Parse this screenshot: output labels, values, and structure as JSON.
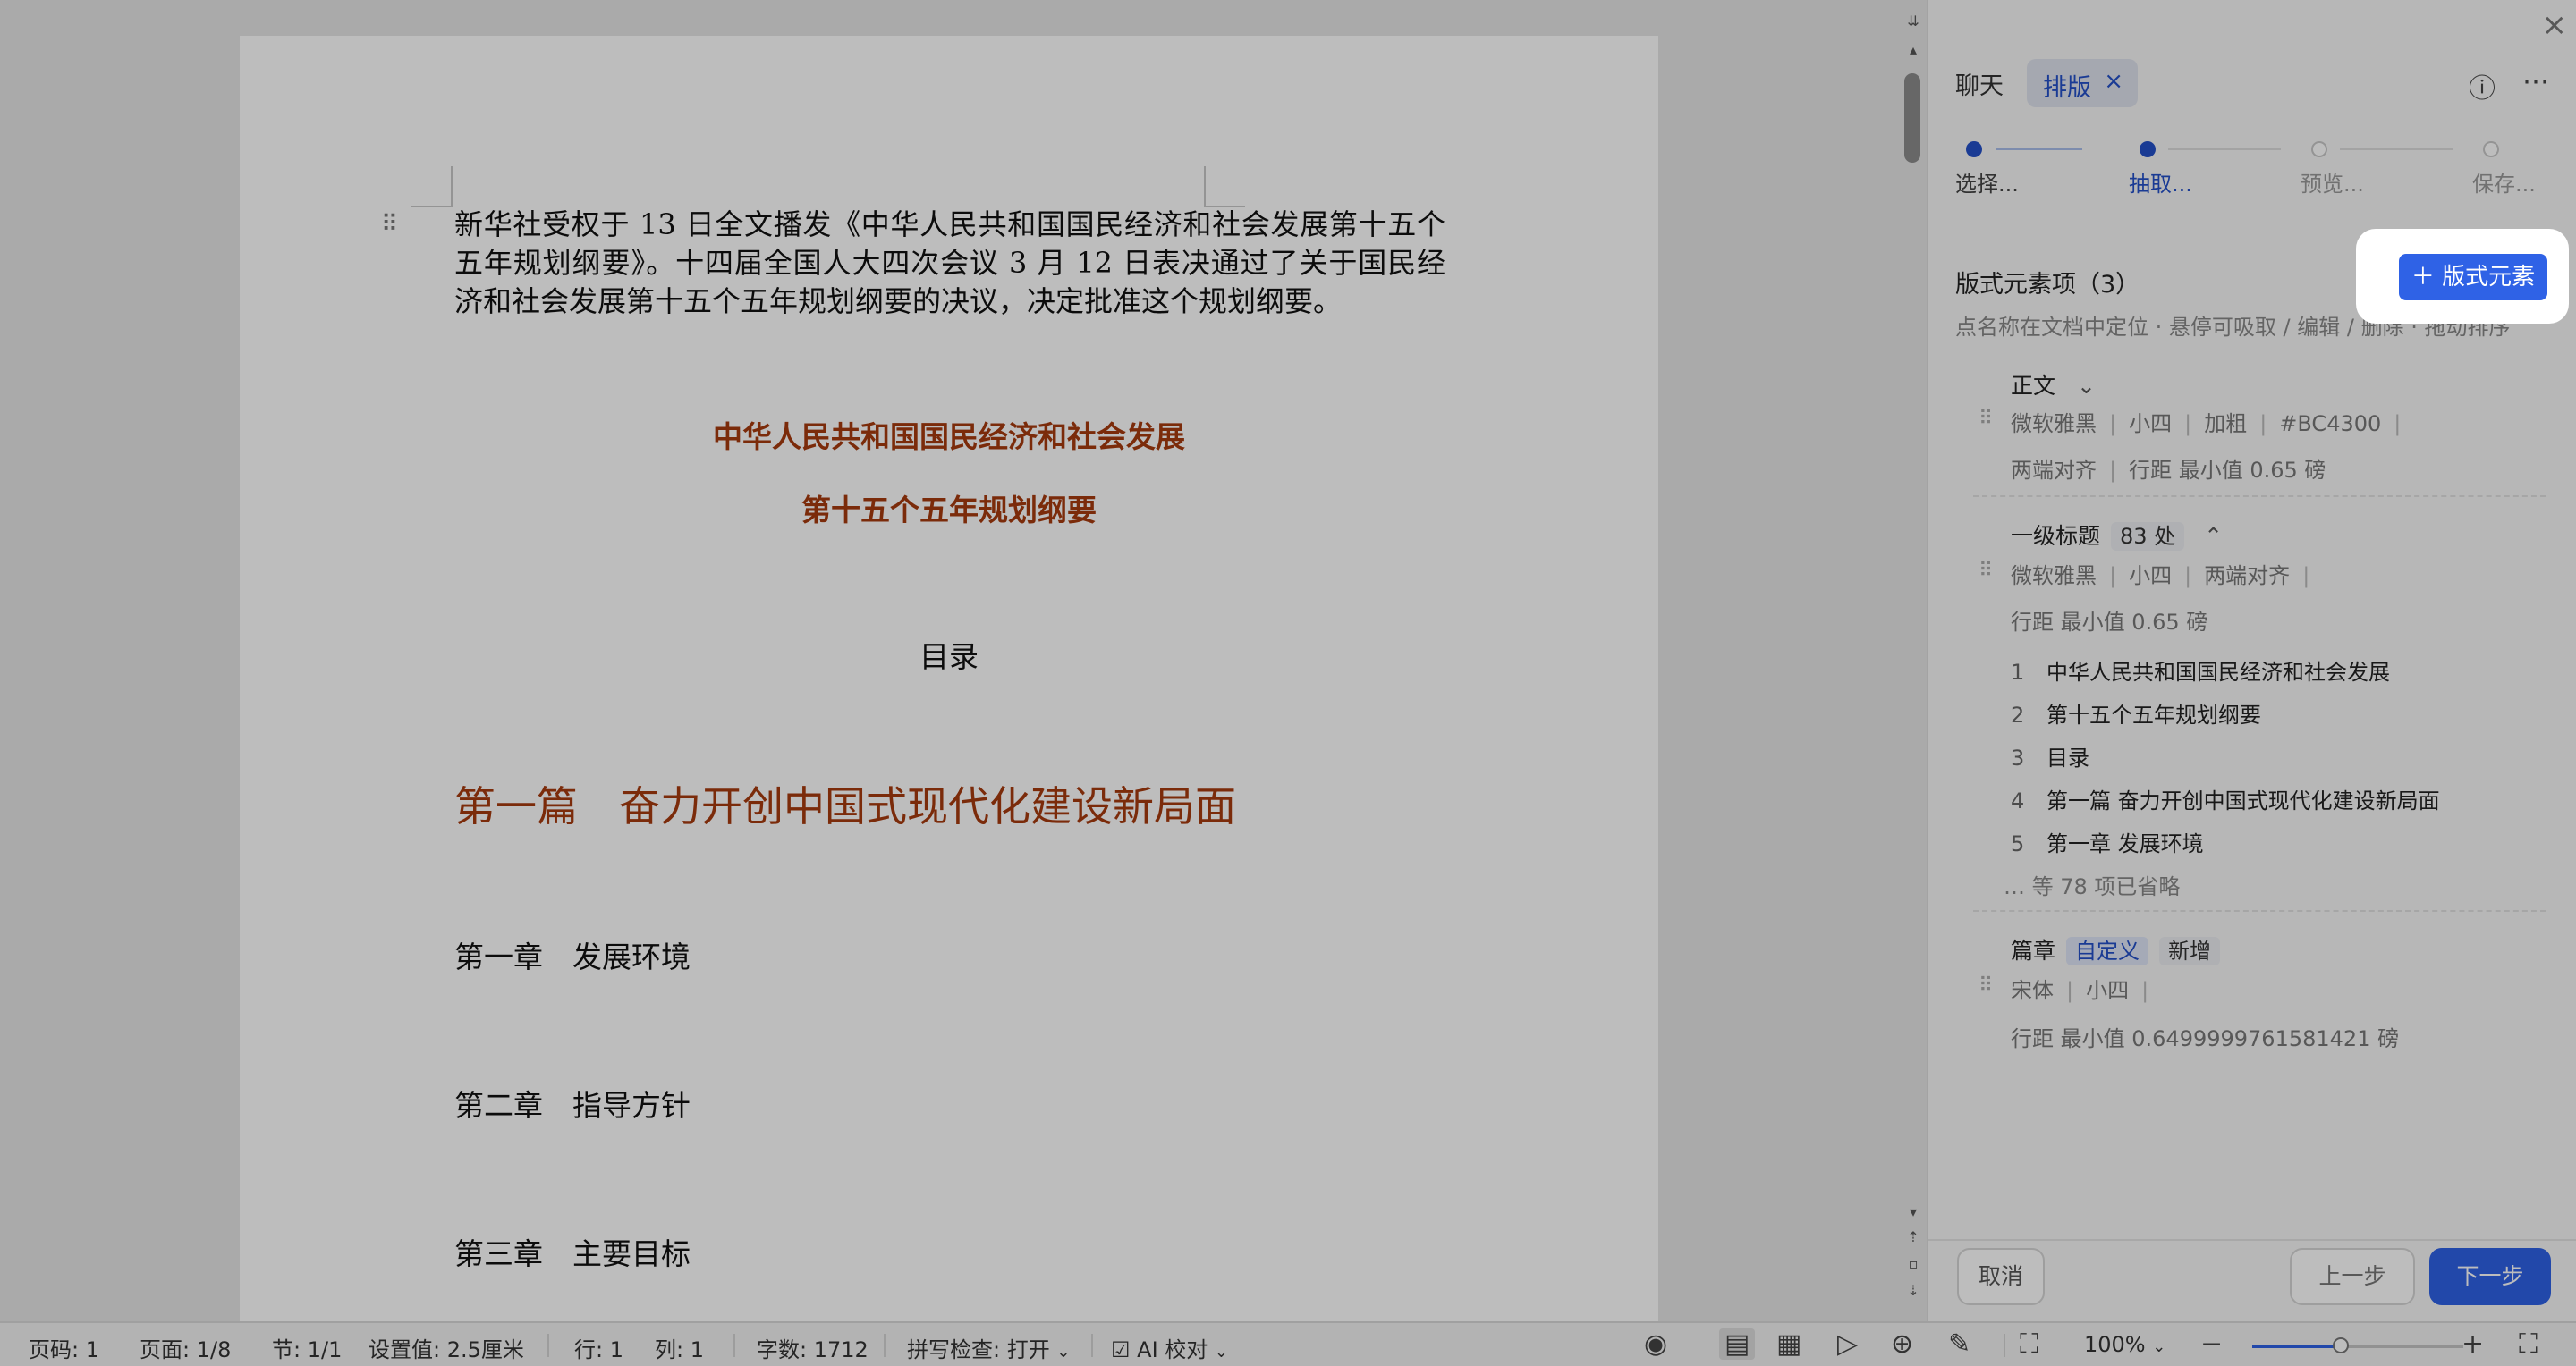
{
  "document": {
    "intro": "新华社受权于 13 日全文播发《中华人民共和国国民经济和社会发展第十五个五年规划纲要》。十四届全国人大四次会议 3 月 12 日表决通过了关于国民经济和社会发展第十五个五年规划纲要的决议，决定批准这个规划纲要。",
    "title1": "中华人民共和国国民经济和社会发展",
    "title2": "第十五个五年规划纲要",
    "toc": "目录",
    "part1": "第一篇　奋力开创中国式现代化建设新局面",
    "chapters": [
      "第一章　发展环境",
      "第二章　指导方针",
      "第三章　主要目标"
    ]
  },
  "panel": {
    "tabs": {
      "chat": "聊天",
      "layout": "排版"
    },
    "steps": [
      "选择...",
      "抽取...",
      "预览...",
      "保存..."
    ],
    "current_step_index": 1,
    "section_title": "版式元素项（3）",
    "add_button": "＋ 版式元素",
    "hint": "点名称在文档中定位 · 悬停可吸取 / 编辑 / 删除 · 拖动排序",
    "elements": [
      {
        "name": "正文",
        "props_line1": [
          "微软雅黑",
          "小四",
          "加粗",
          "#BC4300"
        ],
        "props_line2": [
          "两端对齐",
          "行距 最小值 0.65 磅"
        ]
      },
      {
        "name": "一级标题",
        "count": "83 处",
        "props_line1": [
          "微软雅黑",
          "小四",
          "两端对齐"
        ],
        "props_line2": [
          "行距 最小值 0.65 磅"
        ],
        "items": [
          {
            "num": "1",
            "text": "中华人民共和国国民经济和社会发展"
          },
          {
            "num": "2",
            "text": "第十五个五年规划纲要"
          },
          {
            "num": "3",
            "text": "目录"
          },
          {
            "num": "4",
            "text": "第一篇 奋力开创中国式现代化建设新局面"
          },
          {
            "num": "5",
            "text": "第一章 发展环境"
          }
        ],
        "omitted": "… 等 78 项已省略"
      },
      {
        "name": "篇章",
        "tag_custom": "自定义",
        "tag_new": "新增",
        "props_line1": [
          "宋体",
          "小四"
        ],
        "props_line2": [
          "行距 最小值 0.6499999761581421 磅"
        ]
      }
    ],
    "footer": {
      "cancel": "取消",
      "prev": "上一步",
      "next": "下一步"
    }
  },
  "status": {
    "page_code": "页码: 1",
    "page": "页面: 1/8",
    "section": "节: 1/1",
    "setting": "设置值: 2.5厘米",
    "row": "行: 1",
    "col": "列: 1",
    "words": "字数: 1712",
    "spell": "拼写检查: 打开",
    "ai_check": "AI 校对",
    "zoom": "100%",
    "zoom_level": 0.42
  },
  "colors": {
    "accent": "#2f62e6",
    "heading": "#a73a0e"
  }
}
